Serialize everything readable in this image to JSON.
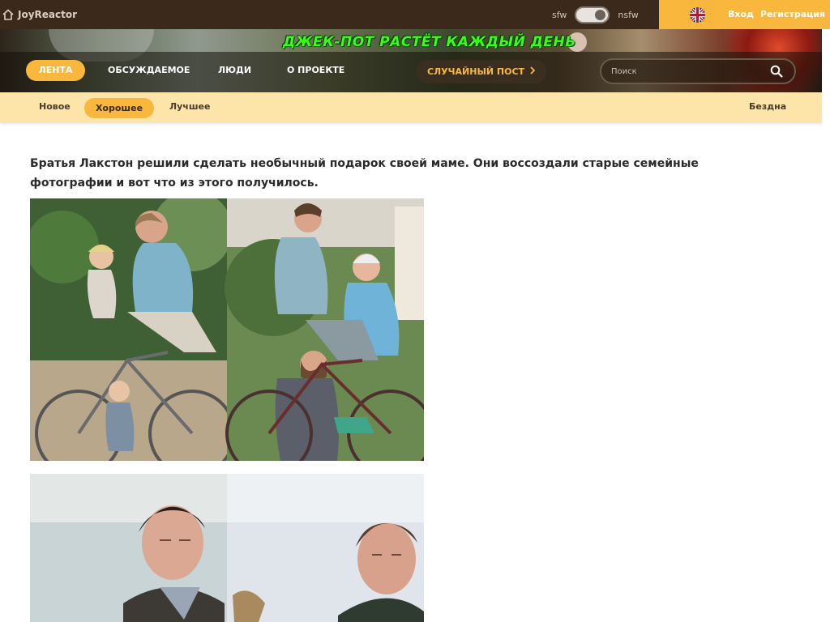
{
  "site": {
    "name": "JoyReactor"
  },
  "mode": {
    "left": "sfw",
    "right": "nsfw"
  },
  "auth": {
    "login": "Вход",
    "register": "Регистрация"
  },
  "banner": {
    "promo": "ДЖЕК-ПОТ РАСТЁТ КАЖДЫЙ ДЕНЬ"
  },
  "main_nav": {
    "items": [
      {
        "label": "ЛЕНТА"
      },
      {
        "label": "ОБСУЖДАЕМОЕ"
      },
      {
        "label": "ЛЮДИ"
      },
      {
        "label": "О ПРОЕКТЕ"
      }
    ],
    "random_post": "СЛУЧАЙНЫЙ ПОСТ"
  },
  "search": {
    "placeholder": "Поиск"
  },
  "sub_nav": {
    "items": [
      {
        "label": "Новое"
      },
      {
        "label": "Хорошее"
      },
      {
        "label": "Лучшее"
      }
    ],
    "abyss": "Бездна"
  },
  "post": {
    "text": "Братья Лакстон решили сделать необычный подарок своей маме. Они воссоздали старые семейные фотографии и вот что из этого получилось."
  },
  "colors": {
    "accent": "#f9b73d",
    "topbar": "#3b2a1c",
    "subnav": "#fde4a9",
    "promo_green": "#39ff14"
  }
}
